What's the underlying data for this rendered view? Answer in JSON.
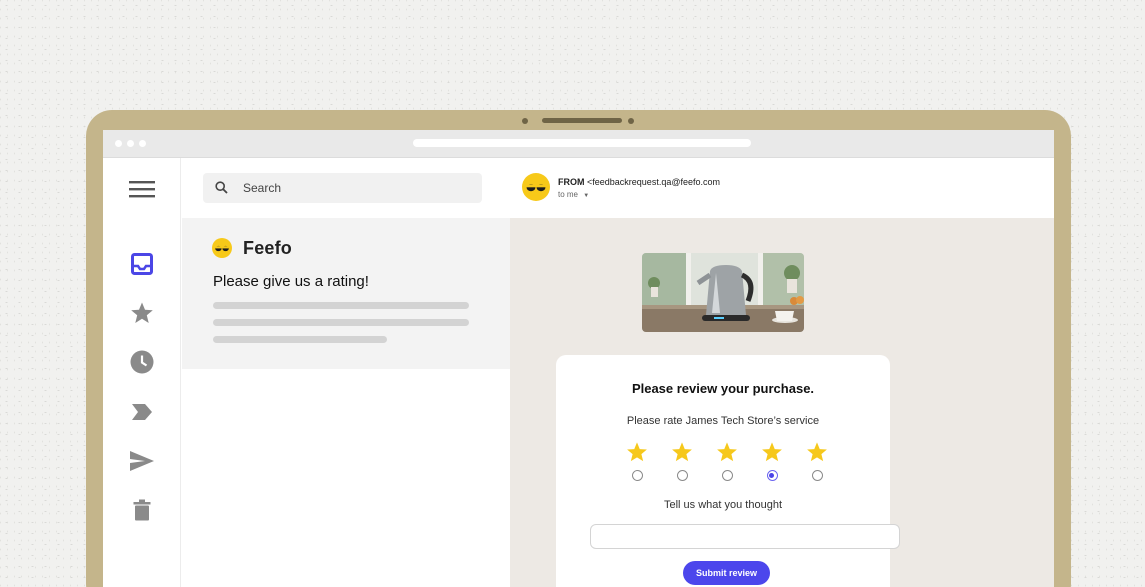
{
  "sidebar": {
    "items": [
      {
        "icon": "menu-icon"
      },
      {
        "icon": "inbox-icon",
        "active": true
      },
      {
        "icon": "star-icon"
      },
      {
        "icon": "clock-icon"
      },
      {
        "icon": "label-icon"
      },
      {
        "icon": "send-icon"
      },
      {
        "icon": "trash-icon"
      }
    ]
  },
  "search": {
    "placeholder": "Search"
  },
  "message_list": {
    "items": [
      {
        "sender": "Feefo",
        "subject": "Please give us a rating!"
      }
    ]
  },
  "email": {
    "from_label": "FROM",
    "from_address": "<feedbackrequest.qa@feefo.com",
    "to": "to me"
  },
  "review": {
    "title": "Please review your purchase.",
    "subtitle": "Please rate James Tech Store’s service",
    "rating": {
      "selected": 4,
      "max": 5
    },
    "thoughts_label": "Tell us what you thought",
    "thoughts_value": "",
    "submit_label": "Submit review"
  },
  "colors": {
    "accent": "#4c46ec",
    "active_icon": "#4b46e6",
    "star": "#f6c81c",
    "brand_yellow": "#f7c919",
    "laptop_bezel": "#c4b58b",
    "email_background": "#ede9e4"
  }
}
